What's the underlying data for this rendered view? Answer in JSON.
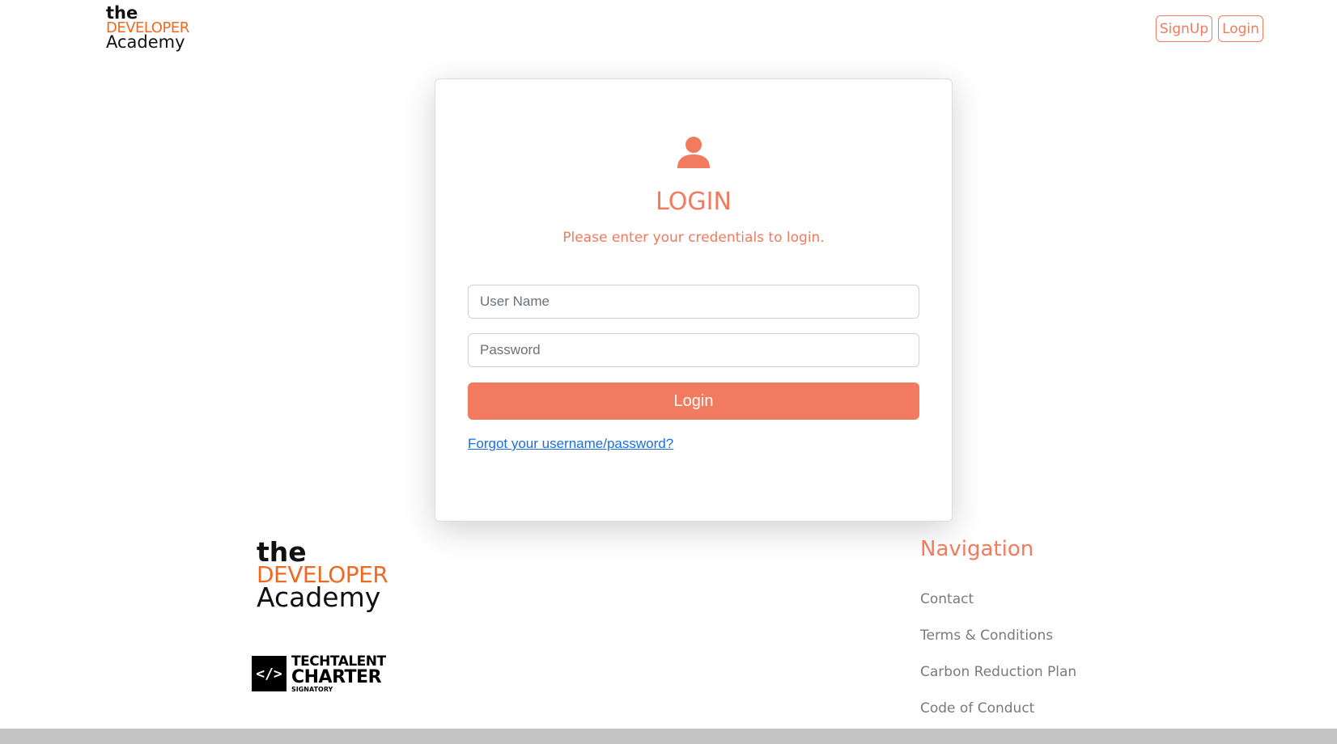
{
  "header": {
    "logo": {
      "line1": "the",
      "line2": "DEVELOPER",
      "line3": "Academy"
    },
    "signup_label": "SignUp",
    "login_label": "Login"
  },
  "login_card": {
    "icon": "user-icon",
    "title": "LOGIN",
    "subtitle": "Please enter your credentials to login.",
    "username_placeholder": "User Name",
    "username_value": "",
    "password_placeholder": "Password",
    "password_value": "",
    "submit_label": "Login",
    "forgot_link": "Forgot your username/password?"
  },
  "footer": {
    "logo": {
      "line1": "the",
      "line2": "DEVELOPER",
      "line3": "Academy"
    },
    "charter": {
      "symbol": "</>",
      "line1": "TECHTALENT",
      "line2": "CHARTER",
      "line3": "SIGNATORY"
    },
    "nav_title": "Navigation",
    "nav_links": [
      "Contact",
      "Terms & Conditions",
      "Carbon Reduction Plan",
      "Code of Conduct"
    ]
  },
  "colors": {
    "accent": "#f27a5e",
    "logo_orange": "#ef6a1f",
    "link_blue": "#1a6fe0",
    "footer_link_gray": "#7a7a7a"
  }
}
